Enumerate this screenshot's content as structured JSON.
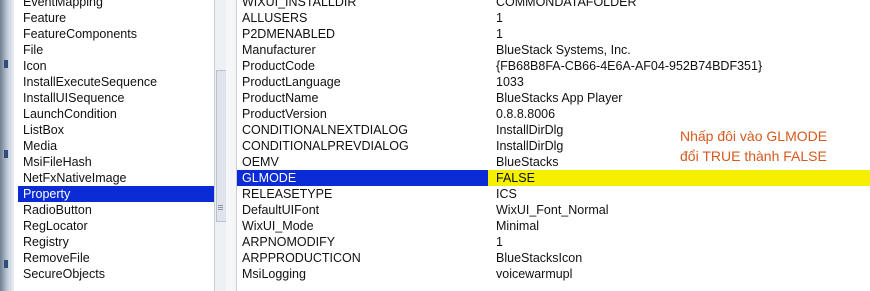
{
  "tables": [
    "EventMapping",
    "Feature",
    "FeatureComponents",
    "File",
    "Icon",
    "InstallExecuteSequence",
    "InstallUISequence",
    "LaunchCondition",
    "ListBox",
    "Media",
    "MsiFileHash",
    "NetFxNativeImage",
    "Property",
    "RadioButton",
    "RegLocator",
    "Registry",
    "RemoveFile",
    "SecureObjects"
  ],
  "selected_table": "Property",
  "properties": [
    {
      "name": "WIXUI_INSTALLDIR",
      "value": "COMMONDATAFOLDER"
    },
    {
      "name": "ALLUSERS",
      "value": "1"
    },
    {
      "name": "P2DMENABLED",
      "value": "1"
    },
    {
      "name": "Manufacturer",
      "value": "BlueStack Systems, Inc."
    },
    {
      "name": "ProductCode",
      "value": "{FB68B8FA-CB66-4E6A-AF04-952B74BDF351}"
    },
    {
      "name": "ProductLanguage",
      "value": "1033"
    },
    {
      "name": "ProductName",
      "value": "BlueStacks App Player"
    },
    {
      "name": "ProductVersion",
      "value": "0.8.8.8006"
    },
    {
      "name": "CONDITIONALNEXTDIALOG",
      "value": "InstallDirDlg"
    },
    {
      "name": "CONDITIONALPREVDIALOG",
      "value": "InstallDirDlg"
    },
    {
      "name": "OEMV",
      "value": "BlueStacks"
    },
    {
      "name": "GLMODE",
      "value": "FALSE"
    },
    {
      "name": "RELEASETYPE",
      "value": "ICS"
    },
    {
      "name": "DefaultUIFont",
      "value": "WixUI_Font_Normal"
    },
    {
      "name": "WixUI_Mode",
      "value": "Minimal"
    },
    {
      "name": "ARPNOMODIFY",
      "value": "1"
    },
    {
      "name": "ARPPRODUCTICON",
      "value": "BlueStacksIcon"
    },
    {
      "name": "MsiLogging",
      "value": "voicewarmupl"
    }
  ],
  "selected_property": "GLMODE",
  "annotation": {
    "line1": "Nhấp đôi vào GLMODE",
    "line2": "đổi TRUE thành FALSE"
  },
  "colors": {
    "selection": "#0a2bd6",
    "highlight": "#f4f000",
    "annotation": "#d65a1e"
  }
}
